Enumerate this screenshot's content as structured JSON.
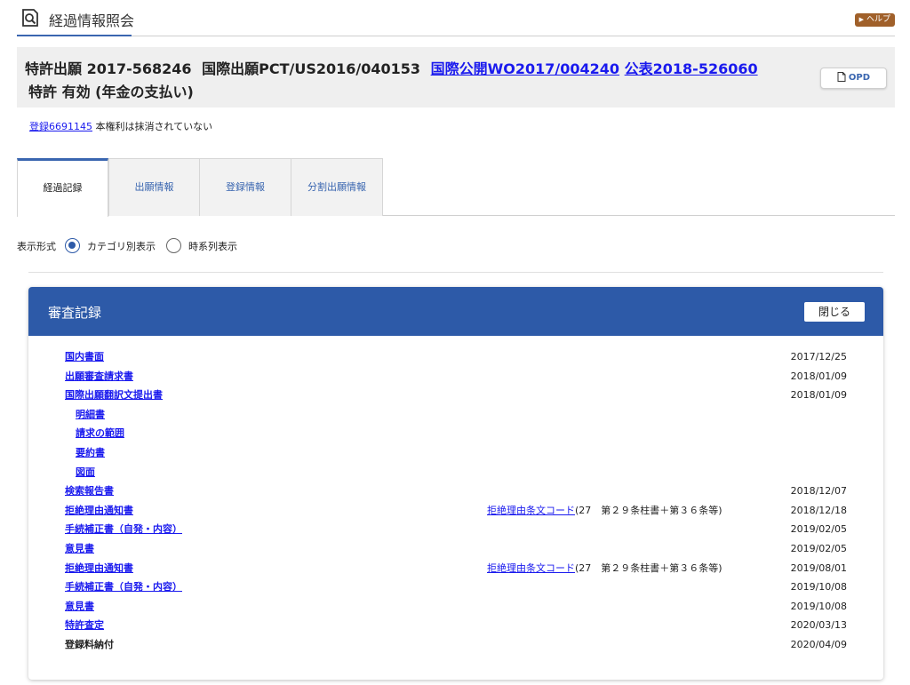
{
  "header": {
    "title": "経過情報照会",
    "help_label": "ヘルプ"
  },
  "case": {
    "application": "特許出願 2017-568246",
    "intl_application": "国際出願PCT/US2016/040153",
    "intl_publication_link": "国際公開WO2017/004240",
    "publication_link": "公表2018-526060",
    "status": "特許 有効 (年金の支払い)",
    "opd_label": "OPD"
  },
  "registration": {
    "link": "登録6691145",
    "note": "本権利は抹消されていない"
  },
  "tabs": [
    {
      "label": "経過記録",
      "active": true
    },
    {
      "label": "出願情報",
      "active": false
    },
    {
      "label": "登録情報",
      "active": false
    },
    {
      "label": "分割出願情報",
      "active": false
    }
  ],
  "display_format": {
    "label": "表示形式",
    "options": [
      {
        "label": "カテゴリ別表示",
        "selected": true
      },
      {
        "label": "時系列表示",
        "selected": false
      }
    ]
  },
  "panel": {
    "title": "審査記録",
    "close_label": "閉じる",
    "rows": [
      {
        "doc": "国内書面",
        "date": "2017/12/25"
      },
      {
        "doc": "出願審査請求書",
        "date": "2018/01/09"
      },
      {
        "doc": "国際出願翻訳文提出書",
        "date": "2018/01/09"
      },
      {
        "doc": "明細書",
        "sub": true
      },
      {
        "doc": "請求の範囲",
        "sub": true
      },
      {
        "doc": "要約書",
        "sub": true
      },
      {
        "doc": "図面",
        "sub": true
      },
      {
        "doc": "検索報告書",
        "date": "2018/12/07"
      },
      {
        "doc": "拒絶理由通知書",
        "reason_link": "拒絶理由条文コード",
        "reason_text": "(27　第２９条柱書＋第３６条等)",
        "date": "2018/12/18"
      },
      {
        "doc": "手続補正書（自発・内容）",
        "date": "2019/02/05"
      },
      {
        "doc": "意見書",
        "date": "2019/02/05"
      },
      {
        "doc": "拒絶理由通知書",
        "reason_link": "拒絶理由条文コード",
        "reason_text": "(27　第２９条柱書＋第３６条等)",
        "date": "2019/08/01"
      },
      {
        "doc": "手続補正書（自発・内容）",
        "date": "2019/10/08"
      },
      {
        "doc": "意見書",
        "date": "2019/10/08"
      },
      {
        "doc": "特許査定",
        "date": "2020/03/13"
      },
      {
        "doc": "登録料納付",
        "date": "2020/04/09",
        "plain": true
      }
    ]
  },
  "colors": {
    "accent": "#2d5aa8",
    "link": "#1a1aee",
    "help_button": "#a0602a"
  }
}
